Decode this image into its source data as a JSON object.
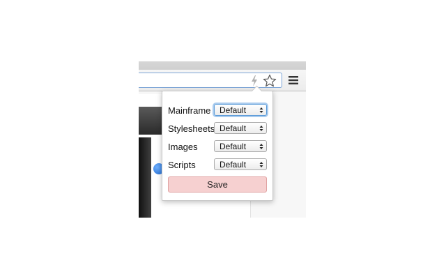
{
  "browser": {
    "icons": {
      "extension": "lightning-bolt-icon",
      "bookmark": "star-icon",
      "menu": "hamburger-menu-icon"
    }
  },
  "popup": {
    "rows": [
      {
        "label": "Mainframe",
        "value": "Default"
      },
      {
        "label": "Stylesheets",
        "value": "Default"
      },
      {
        "label": "Images",
        "value": "Default"
      },
      {
        "label": "Scripts",
        "value": "Default"
      }
    ],
    "save_label": "Save"
  },
  "colors": {
    "save_button_bg": "#f6d0d0",
    "focus_ring": "#5b9bd8"
  }
}
